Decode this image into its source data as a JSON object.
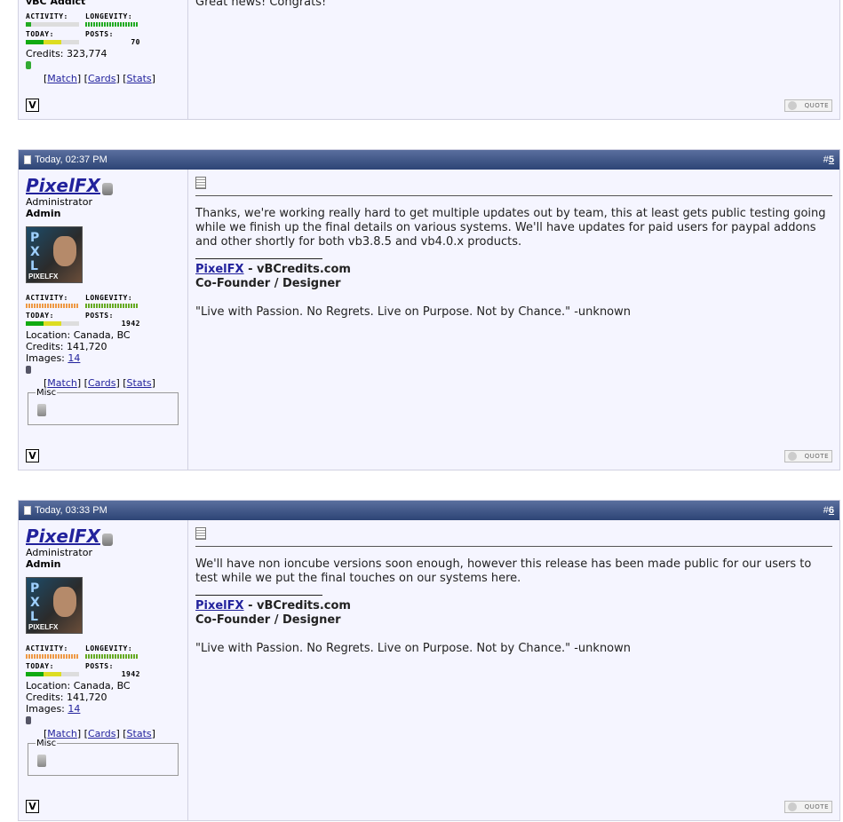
{
  "post_top": {
    "username_fragment": "vBC Addict",
    "meters": {
      "activity": "ACTIVITY:",
      "longevity": "LONGEVITY:",
      "today": "TODAY:",
      "posts": "POSTS:",
      "posts_value": "70"
    },
    "credits": "Credits: 323,774",
    "links": {
      "match": "Match",
      "cards": "Cards",
      "stats": "Stats"
    },
    "message": "Great news! Congrats!",
    "quote_label": "QUOTE"
  },
  "posts": [
    {
      "date": "Today, 02:37 PM",
      "number_prefix": "#",
      "number": "5",
      "username": "PixelFX",
      "user_title": "Administrator",
      "user_rank": "Admin",
      "avatar_letters": "P\nX\nL",
      "avatar_label": "PIXELFX",
      "meters": {
        "activity": "ACTIVITY:",
        "longevity": "LONGEVITY:",
        "today": "TODAY:",
        "posts": "POSTS:",
        "posts_value": "1942"
      },
      "location": "Location: Canada, BC",
      "credits": "Credits: 141,720",
      "images_label": "Images:",
      "images_value": "14",
      "links": {
        "match": "Match",
        "cards": "Cards",
        "stats": "Stats"
      },
      "misc_label": "Misc",
      "message": "Thanks, we're working really hard to get multiple updates out by team, this at least gets public testing going while we finish up the final details on various systems. We'll have updates for paid users for paypal addons and other shortly for both vb3.8.5 and vb4.0.x products.",
      "sig_link": "PixelFX",
      "sig_site": " - vBCredits.com",
      "sig_role": "Co-Founder / Designer",
      "sig_quote": "\"Live with Passion. No Regrets. Live on Purpose. Not by Chance.\" -unknown",
      "quote_label": "QUOTE"
    },
    {
      "date": "Today, 03:33 PM",
      "number_prefix": "#",
      "number": "6",
      "username": "PixelFX",
      "user_title": "Administrator",
      "user_rank": "Admin",
      "avatar_letters": "P\nX\nL",
      "avatar_label": "PIXELFX",
      "meters": {
        "activity": "ACTIVITY:",
        "longevity": "LONGEVITY:",
        "today": "TODAY:",
        "posts": "POSTS:",
        "posts_value": "1942"
      },
      "location": "Location: Canada, BC",
      "credits": "Credits: 141,720",
      "images_label": "Images:",
      "images_value": "14",
      "links": {
        "match": "Match",
        "cards": "Cards",
        "stats": "Stats"
      },
      "misc_label": "Misc",
      "message": "We'll have non ioncube versions soon enough, however this release has been made public for our users to test while we put the final touches on our systems here.",
      "sig_link": "PixelFX",
      "sig_site": " - vBCredits.com",
      "sig_role": "Co-Founder / Designer",
      "sig_quote": "\"Live with Passion. No Regrets. Live on Purpose. Not by Chance.\" -unknown",
      "quote_label": "QUOTE"
    }
  ]
}
